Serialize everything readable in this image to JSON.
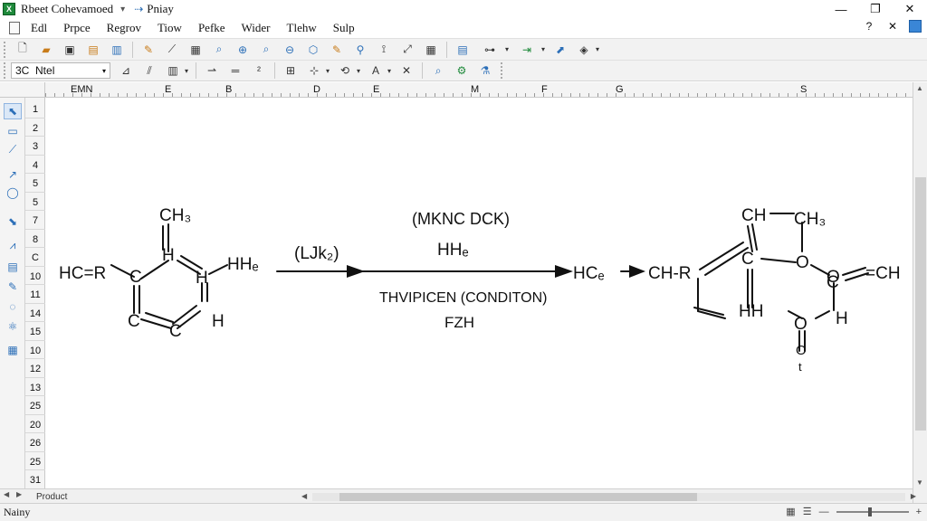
{
  "window": {
    "title": "Rbeet Cohevamoed",
    "title_dropdown": "▾",
    "document": "Pniay",
    "controls": {
      "minimize": "—",
      "maximize": "❐",
      "close": "✕"
    }
  },
  "menu": {
    "items": [
      "Edl",
      "Prpce",
      "Regrov",
      "Tiow",
      "Pefke",
      "Wider",
      "Tlehw",
      "Sulp"
    ],
    "right": {
      "help_q": "?",
      "close": "✕"
    }
  },
  "toolbar2": {
    "font_size": "3C",
    "font_name": "Ntel",
    "text_button": "A"
  },
  "columns": [
    "EMN",
    "E",
    "B",
    "D",
    "E",
    "M",
    "F",
    "G",
    "S"
  ],
  "rows": [
    "1",
    "2",
    "3",
    "4",
    "5",
    "5",
    "7",
    "8",
    "C",
    "10",
    "11",
    "14",
    "15",
    "10",
    "12",
    "13",
    "25",
    "20",
    "26",
    "25",
    "31"
  ],
  "scheme": {
    "reactant": {
      "top_group": "CH₃",
      "top_h": "H",
      "left_label": "HC=R",
      "right_group": "HHₑ",
      "c_left": "C",
      "c_bottom": "C",
      "bottom_c": "C",
      "bottom_h": "H",
      "right_h": "H"
    },
    "step1": {
      "reagent": "(LJk₂)"
    },
    "step2": {
      "above_1": "(MKNC DCK)",
      "above_2": "HHₑ",
      "below_1": "THVIPICEN (CONDITON)",
      "below_2": "FZH",
      "intermediate": "HCₑ"
    },
    "product": {
      "ch_left": "CH-R",
      "top_ch": "CH",
      "top_ch3": "CH₃",
      "c_1": "C",
      "o_1": "O",
      "c_2": "O",
      "c_3": "C",
      "ch_right": "=CH",
      "hh": "HH",
      "o_2": "O",
      "h_right": "H",
      "o_bottom": "O",
      "t": "t"
    }
  },
  "sheet_tab": "Product",
  "status": {
    "text": "Nainy"
  }
}
